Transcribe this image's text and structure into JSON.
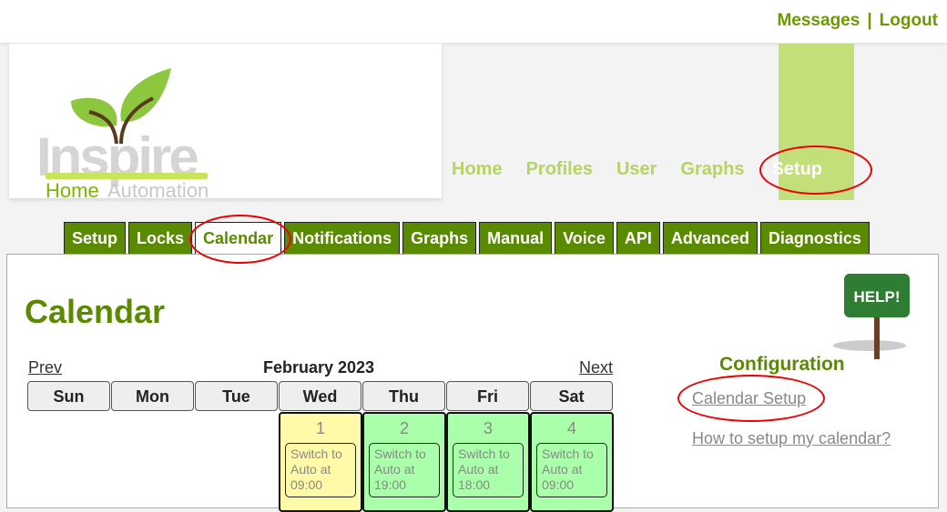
{
  "top": {
    "messages": "Messages",
    "sep": "|",
    "logout": "Logout"
  },
  "logo": {
    "text1": "Inspire",
    "text2": "Home",
    "text3": "Automation"
  },
  "nav": [
    {
      "label": "Home"
    },
    {
      "label": "Profiles"
    },
    {
      "label": "User"
    },
    {
      "label": "Graphs"
    },
    {
      "label": "Setup"
    }
  ],
  "tabs": [
    {
      "label": "Setup"
    },
    {
      "label": "Locks"
    },
    {
      "label": "Calendar"
    },
    {
      "label": "Notifications"
    },
    {
      "label": "Graphs"
    },
    {
      "label": "Manual"
    },
    {
      "label": "Voice"
    },
    {
      "label": "API"
    },
    {
      "label": "Advanced"
    },
    {
      "label": "Diagnostics"
    }
  ],
  "page": {
    "title": "Calendar",
    "help_sign": "HELP!"
  },
  "calendar": {
    "prev": "Prev",
    "next": "Next",
    "month": "February 2023",
    "weekdays": [
      "Sun",
      "Mon",
      "Tue",
      "Wed",
      "Thu",
      "Fri",
      "Sat"
    ],
    "days": [
      {
        "num": "1",
        "event": "Switch to Auto at 09:00",
        "color": "#fffaa8"
      },
      {
        "num": "2",
        "event": "Switch to Auto at 19:00",
        "color": "#aaffaa"
      },
      {
        "num": "3",
        "event": "Switch to Auto at 18:00",
        "color": "#aaffaa"
      },
      {
        "num": "4",
        "event": "Switch to Auto at 09:00",
        "color": "#aaffaa"
      }
    ]
  },
  "config": {
    "heading": "Configuration",
    "setup_link": "Calendar Setup",
    "howto_link": "How to setup my calendar?"
  },
  "colors": {
    "brand": "#5a8a00",
    "nav": "#b5d560",
    "annotation": "#e00000"
  }
}
